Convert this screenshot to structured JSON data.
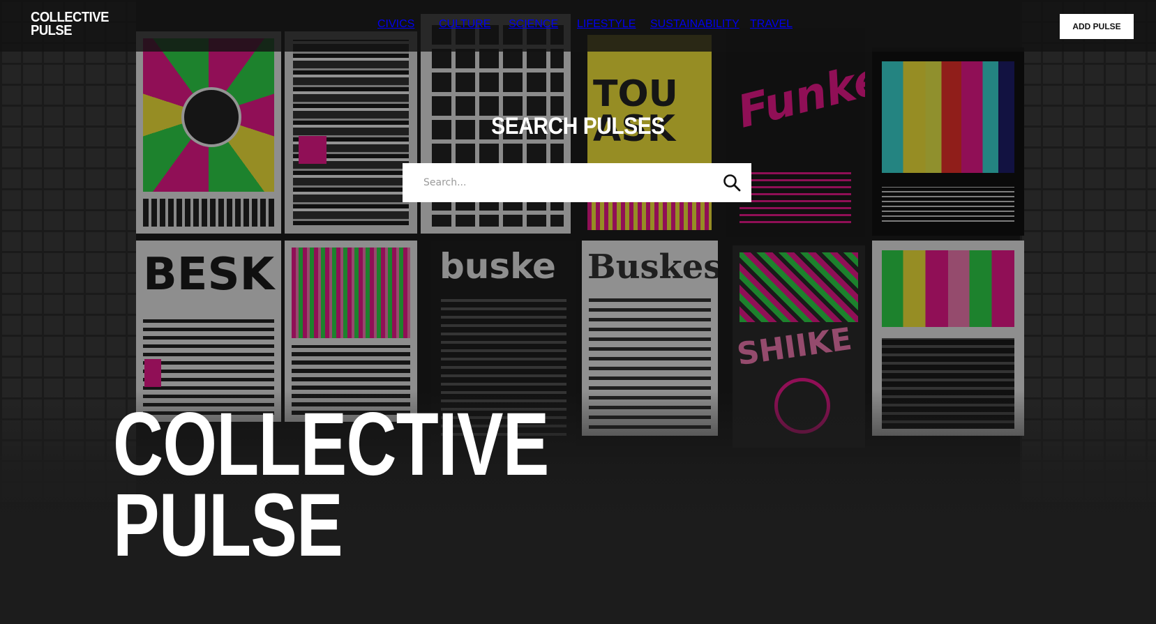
{
  "header": {
    "logo_line1": "COLLECTIVE",
    "logo_line2": "PULSE",
    "nav": [
      {
        "label": "CIVICS"
      },
      {
        "label": "CULTURE"
      },
      {
        "label": "SCIENCE"
      },
      {
        "label": "LIFESTYLE"
      },
      {
        "label": "SUSTAINABILITY"
      },
      {
        "label": "TRAVEL"
      }
    ],
    "cta_label": "ADD PULSE"
  },
  "search": {
    "title": "SEARCH PULSES",
    "placeholder": "Search...",
    "value": "",
    "icon": "search-icon"
  },
  "hero": {
    "title_line1": "COLLECTIVE",
    "title_line2": "PULSE"
  },
  "posters": {
    "texts": [
      "BESK",
      "buske",
      "Buskes",
      "SHIIKE",
      "TOU ASK",
      "Funke"
    ]
  },
  "colors": {
    "background": "#1c1c1c",
    "white": "#ffffff",
    "accent_pink": "#e8198b",
    "accent_green": "#2fd24a",
    "accent_yellow": "#f2e43a",
    "accent_cyan": "#3ad6d0"
  }
}
